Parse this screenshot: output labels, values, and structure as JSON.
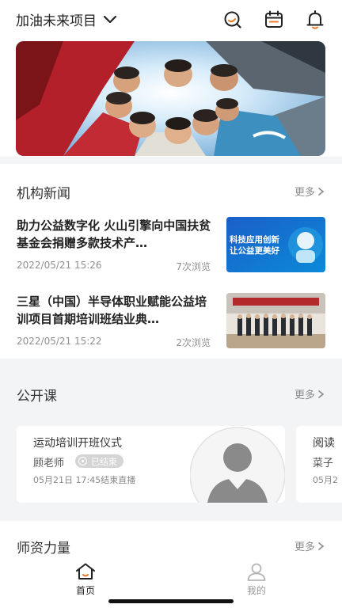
{
  "header": {
    "project_title": "加油未来项目",
    "icons": [
      "search-icon",
      "calendar-icon",
      "bell-icon"
    ]
  },
  "colors": {
    "accent": "#e87a2c",
    "muted_bg": "#f3f4f6",
    "badge_bg": "#d5d5d5"
  },
  "news": {
    "section_title": "机构新闻",
    "more_label": "更多",
    "items": [
      {
        "title": "助力公益数字化 火山引擎向中国扶贫基金会捐赠多款技术产…",
        "date": "2022/05/21 15:26",
        "views": "7次浏览",
        "thumb_text_1": "科技应用创新",
        "thumb_text_2": "让公益更美好"
      },
      {
        "title": "三星（中国）半导体职业赋能公益培训项目首期培训班结业典…",
        "date": "2022/05/21 15:22",
        "views": "2次浏览"
      }
    ]
  },
  "courses": {
    "section_title": "公开课",
    "more_label": "更多",
    "items": [
      {
        "title": "运动培训开班仪式",
        "teacher": "顾老师",
        "status": "已结束",
        "time": "05月21日 17:45结束直播"
      },
      {
        "title": "阅读",
        "teacher": "菜子",
        "time": "05月2"
      }
    ]
  },
  "faculty": {
    "section_title": "师资力量",
    "more_label": "更多"
  },
  "tabbar": {
    "home_label": "首页",
    "mine_label": "我的"
  }
}
